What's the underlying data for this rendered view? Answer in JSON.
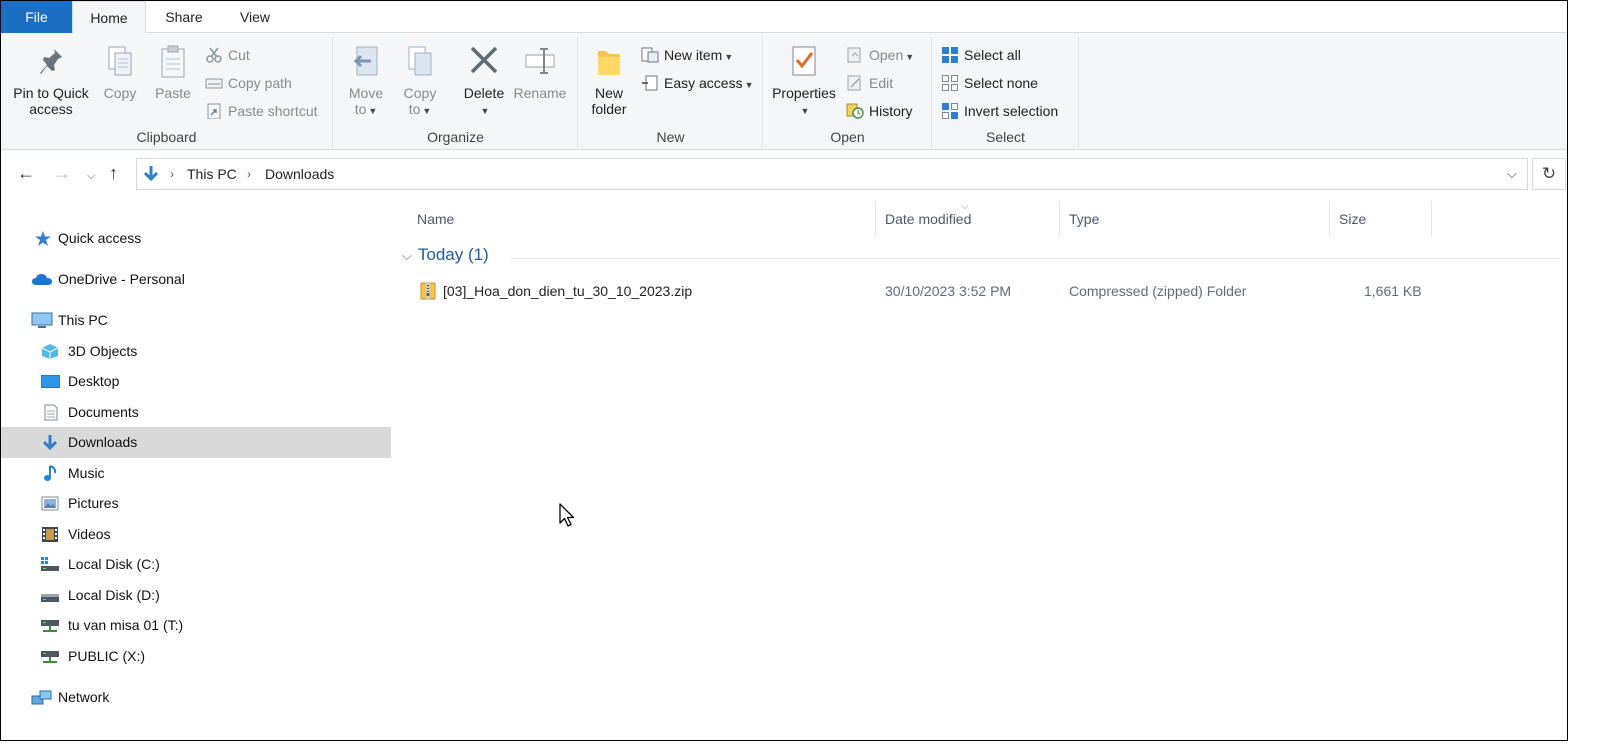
{
  "tabs": {
    "file": "File",
    "home": "Home",
    "share": "Share",
    "view": "View"
  },
  "ribbon": {
    "clipboard": {
      "label": "Clipboard",
      "pin_line1": "Pin to Quick",
      "pin_line2": "access",
      "copy": "Copy",
      "paste": "Paste",
      "cut": "Cut",
      "copy_path": "Copy path",
      "paste_shortcut": "Paste shortcut"
    },
    "organize": {
      "label": "Organize",
      "move_line1": "Move",
      "move_line2": "to",
      "copy_line1": "Copy",
      "copy_line2": "to",
      "delete": "Delete",
      "rename": "Rename"
    },
    "new": {
      "label": "New",
      "folder_line1": "New",
      "folder_line2": "folder",
      "new_item": "New item",
      "easy_access": "Easy access"
    },
    "open": {
      "label": "Open",
      "properties": "Properties",
      "open": "Open",
      "edit": "Edit",
      "history": "History"
    },
    "select": {
      "label": "Select",
      "select_all": "Select all",
      "select_none": "Select none",
      "invert": "Invert selection"
    }
  },
  "address": {
    "crumbs": [
      "This PC",
      "Downloads"
    ]
  },
  "sidebar": {
    "items": [
      {
        "label": "Quick access",
        "icon": "star-icon"
      },
      {
        "label": "OneDrive - Personal",
        "icon": "cloud-icon"
      },
      {
        "label": "This PC",
        "icon": "computer-icon"
      },
      {
        "label": "3D Objects",
        "icon": "cube-icon"
      },
      {
        "label": "Desktop",
        "icon": "desktop-icon"
      },
      {
        "label": "Documents",
        "icon": "document-icon"
      },
      {
        "label": "Downloads",
        "icon": "download-icon"
      },
      {
        "label": "Music",
        "icon": "music-note-icon"
      },
      {
        "label": "Pictures",
        "icon": "picture-icon"
      },
      {
        "label": "Videos",
        "icon": "film-icon"
      },
      {
        "label": "Local Disk (C:)",
        "icon": "system-drive-icon"
      },
      {
        "label": "Local Disk (D:)",
        "icon": "drive-icon"
      },
      {
        "label": "tu van misa 01 (T:)",
        "icon": "network-drive-icon"
      },
      {
        "label": "PUBLIC (X:)",
        "icon": "network-drive-icon"
      },
      {
        "label": "Network",
        "icon": "network-icon"
      }
    ]
  },
  "columns": {
    "name": "Name",
    "date": "Date modified",
    "type": "Type",
    "size": "Size"
  },
  "group": {
    "label": "Today (1)"
  },
  "files": [
    {
      "name": "[03]_Hoa_don_dien_tu_30_10_2023.zip",
      "date": "30/10/2023 3:52 PM",
      "type": "Compressed (zipped) Folder",
      "size": "1,661 KB"
    }
  ],
  "colors": {
    "accent": "#1a6fc4",
    "selected": "#d9d9d9",
    "group_header": "#1e5ba8"
  }
}
